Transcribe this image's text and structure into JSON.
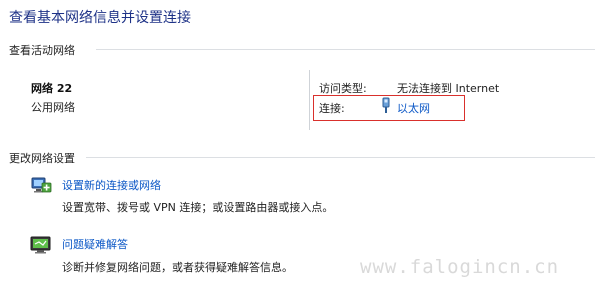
{
  "page_title": "查看基本网络信息并设置连接",
  "active_network_section": {
    "title": "查看活动网络",
    "network_name": "网络 22",
    "network_type": "公用网络",
    "access_type_label": "访问类型:",
    "access_type_value": "无法连接到 Internet",
    "connection_label": "连接:",
    "connection_value": "以太网"
  },
  "change_settings_section": {
    "title": "更改网络设置",
    "items": [
      {
        "icon": "new-connection-icon",
        "link_text": "设置新的连接或网络",
        "description": "设置宽带、拨号或 VPN 连接；或设置路由器或接入点。"
      },
      {
        "icon": "troubleshoot-icon",
        "link_text": "问题疑难解答",
        "description": "诊断并修复网络问题，或者获得疑难解答信息。"
      }
    ]
  },
  "watermark": "www.falogincn.cn",
  "colors": {
    "title_blue": "#1e3287",
    "link_blue": "#0b57c6",
    "highlight_red": "#d9302c",
    "watermark_gray": "#d9d9d9"
  }
}
